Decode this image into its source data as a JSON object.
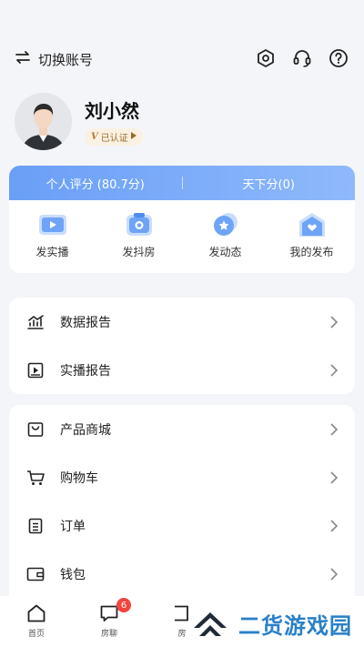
{
  "header": {
    "switch_label": "切换账号",
    "icons": [
      "settings-icon",
      "customer-service-icon",
      "help-icon"
    ]
  },
  "profile": {
    "name": "刘小然",
    "verify_label": "已认证"
  },
  "score": {
    "personal": "个人评分 (80.7分)",
    "world": "天下分(0)"
  },
  "actions": [
    {
      "label": "发实播",
      "icon": "live-video-icon"
    },
    {
      "label": "发抖房",
      "icon": "camera-icon"
    },
    {
      "label": "发动态",
      "icon": "star-bubble-icon"
    },
    {
      "label": "我的发布",
      "icon": "heart-house-icon"
    }
  ],
  "menu_reports": [
    {
      "label": "数据报告",
      "icon": "chart-icon"
    },
    {
      "label": "实播报告",
      "icon": "play-report-icon"
    }
  ],
  "menu_shop": [
    {
      "label": "产品商城",
      "icon": "shopping-bag-icon"
    },
    {
      "label": "购物车",
      "icon": "cart-icon"
    },
    {
      "label": "订单",
      "icon": "order-icon"
    },
    {
      "label": "钱包",
      "icon": "wallet-icon"
    }
  ],
  "tabs": [
    {
      "label": "首页",
      "icon": "home-icon"
    },
    {
      "label": "房聊",
      "icon": "chat-icon",
      "badge": "6"
    },
    {
      "label": "房",
      "icon": "house-tab-icon"
    }
  ],
  "watermark": {
    "text": "二货游戏园"
  },
  "colors": {
    "accent": "#6a9ff7",
    "badge": "#f1453d",
    "watermark": "#2a80c8"
  }
}
